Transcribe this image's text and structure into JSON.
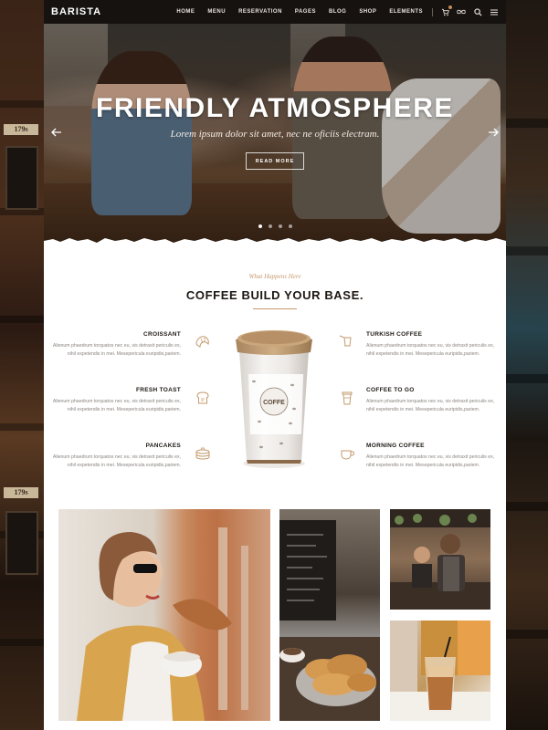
{
  "header": {
    "logo": "BARISTA",
    "nav": [
      "HOME",
      "MENU",
      "RESERVATION",
      "PAGES",
      "BLOG",
      "SHOP",
      "ELEMENTS"
    ],
    "icons": [
      "cart-icon",
      "glasses-icon",
      "search-icon",
      "menu-icon"
    ]
  },
  "hero": {
    "title": "FRIENDLY ATMOSPHERE",
    "subtitle": "Lorem ipsum dolor sit amet, nec ne oficiis electram.",
    "button": "READ MORE",
    "slides": 4,
    "active_slide": 1
  },
  "section": {
    "kicker": "What Happens Here",
    "title": "COFFEE BUILD YOUR BASE."
  },
  "features_left": [
    {
      "title": "CROISSANT",
      "text": "Alienum phaedrum torquatos nec eu, vis detraxit periculis ex, nihil expetendis in mei. Mesepericula euripidis,pariem."
    },
    {
      "title": "FRESH TOAST",
      "text": "Alienum phaedrum torquatos nec eu, vis detraxit periculis ex, nihil expetendis in mei. Mesepericula euripidis,pariem."
    },
    {
      "title": "PANCAKES",
      "text": "Alienum phaedrum torquatos nec eu, vis detraxit periculis ex, nihil expetendis in mei. Mesepericula euripidis,pariem."
    }
  ],
  "features_right": [
    {
      "title": "TURKISH COFFEE",
      "text": "Alienum phaedrum torquatos nec eu, vis detraxit periculis ex, nihil expetendis in mei. Mesepericula euripidis,pariem."
    },
    {
      "title": "COFFEE TO GO",
      "text": "Alienum phaedrum torquatos nec eu, vis detraxit periculis ex, nihil expetendis in mei. Mesepericula euripidis,pariem."
    },
    {
      "title": "MORNING COFFEE",
      "text": "Alienum phaedrum torquatos nec eu, vis detraxit periculis ex, nihil expetendis in mei. Mesepericula euripidis,pariem."
    }
  ],
  "cup": {
    "label": "COFFE"
  },
  "background": {
    "sign": "179s"
  },
  "colors": {
    "accent": "#c49a6c",
    "topbar": "#161210",
    "text": "#1c1712"
  }
}
